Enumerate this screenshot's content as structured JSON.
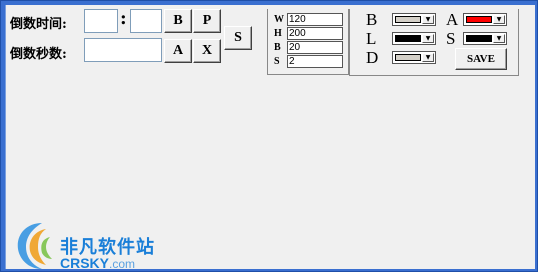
{
  "countdown": {
    "time_label": "倒数时间:",
    "colon": ":",
    "seconds_label": "倒数秒数:",
    "hour_value": "",
    "minute_value": "",
    "seconds_value": ""
  },
  "buttons": {
    "b": "B",
    "p": "P",
    "a": "A",
    "x": "X",
    "s": "S",
    "save": "SAVE"
  },
  "whbs": [
    {
      "key": "W",
      "value": "120"
    },
    {
      "key": "H",
      "value": " 200"
    },
    {
      "key": "B",
      "value": "20"
    },
    {
      "key": "S",
      "value": "2"
    }
  ],
  "colors": {
    "b_label": "B",
    "l_label": "L",
    "d_label": "D",
    "a_label": "A",
    "s_label": "S",
    "b_color": "#d4d0c8",
    "l_color": "#000000",
    "d_color": "#d4d0c8",
    "a_color": "#ff0000",
    "s_color": "#000000",
    "dropdown_glyph": "▼"
  },
  "watermark": {
    "cn": "非凡软件站",
    "en": "CRSKY",
    "domain": ".com"
  }
}
